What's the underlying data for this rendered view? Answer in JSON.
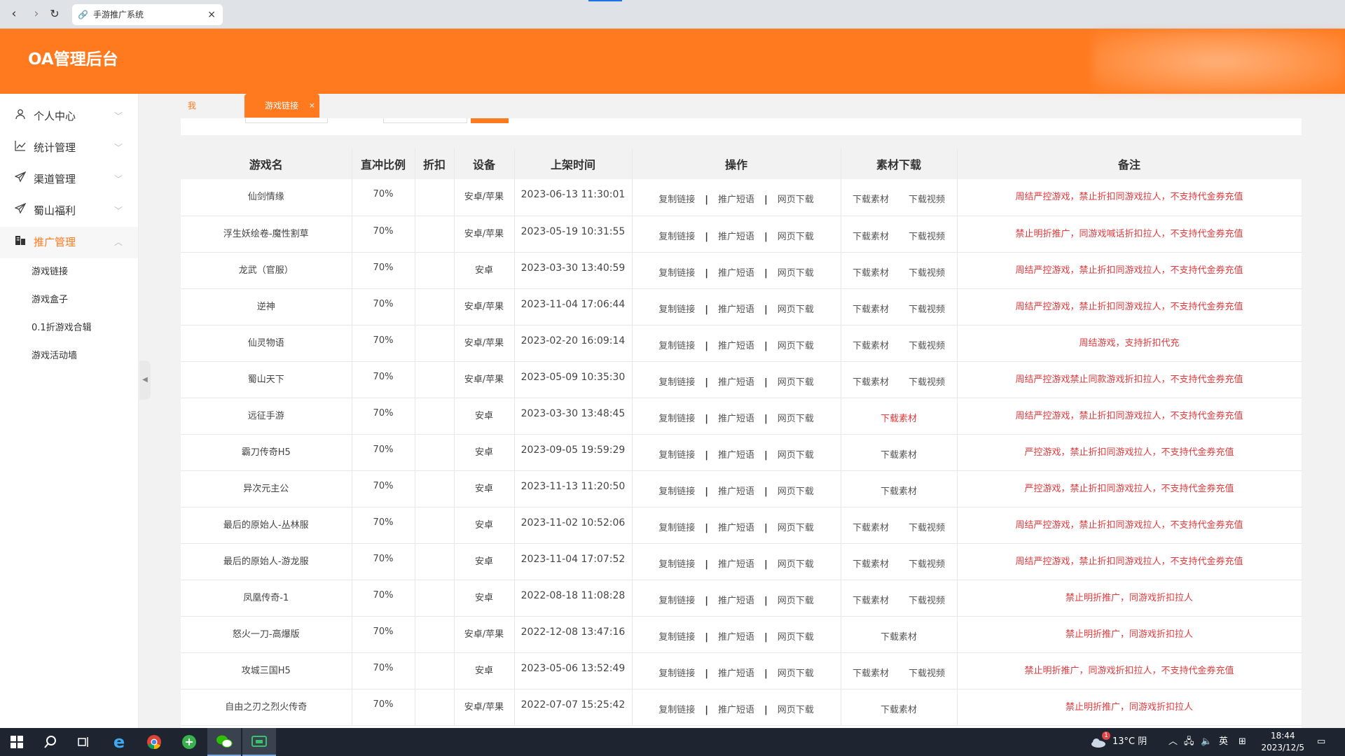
{
  "browser": {
    "tab_title": "手游推广系统",
    "back": "‹",
    "forward": "›",
    "reload": "↻",
    "close": "×"
  },
  "header": {
    "brand": "OA管理后台"
  },
  "sidebar": {
    "menu": [
      {
        "label": "个人中心",
        "icon": "user-icon"
      },
      {
        "label": "统计管理",
        "icon": "chart-line-icon"
      },
      {
        "label": "渠道管理",
        "icon": "send-icon"
      },
      {
        "label": "蜀山福利",
        "icon": "send-icon"
      },
      {
        "label": "推广管理",
        "icon": "building-icon"
      }
    ],
    "submenu": [
      "游戏链接",
      "游戏盒子",
      "0.1折游戏合辑",
      "游戏活动墙"
    ]
  },
  "content_tabs": {
    "home": "我的桌面",
    "current": "游戏链接",
    "close": "×"
  },
  "table": {
    "headers": [
      "游戏名",
      "直冲比例",
      "折扣",
      "设备",
      "上架时间",
      "操作",
      "素材下载",
      "备注"
    ],
    "ops": [
      "复制链接",
      "推广短语",
      "网页下载"
    ],
    "mat_material": "下载素材",
    "mat_video": "下载视频",
    "rows": [
      {
        "name": "仙剑情缘",
        "ratio": "70%",
        "discount": "",
        "device": "安卓/苹果",
        "time": "2023-06-13 11:30:01",
        "mat": "both",
        "note": "周结严控游戏，禁止折扣同游戏拉人，不支持代金券充值"
      },
      {
        "name": "浮生妖绘卷-魔性割草",
        "ratio": "70%",
        "discount": "",
        "device": "安卓/苹果",
        "time": "2023-05-19 10:31:55",
        "mat": "both",
        "note": "禁止明折推广，同游戏喊话折扣拉人，不支持代金券充值"
      },
      {
        "name": "龙武（官服）",
        "ratio": "70%",
        "discount": "",
        "device": "安卓",
        "time": "2023-03-30 13:40:59",
        "mat": "both",
        "note": "周结严控游戏，禁止折扣同游戏拉人，不支持代金券充值"
      },
      {
        "name": "逆神",
        "ratio": "70%",
        "discount": "",
        "device": "安卓/苹果",
        "time": "2023-11-04 17:06:44",
        "mat": "both",
        "note": "周结严控游戏，禁止折扣同游戏拉人，不支持代金券充值"
      },
      {
        "name": "仙灵物语",
        "ratio": "70%",
        "discount": "",
        "device": "安卓/苹果",
        "time": "2023-02-20 16:09:14",
        "mat": "both",
        "note": "周结游戏，支持折扣代充"
      },
      {
        "name": "蜀山天下",
        "ratio": "70%",
        "discount": "",
        "device": "安卓/苹果",
        "time": "2023-05-09 10:35:30",
        "mat": "both",
        "note": "周结严控游戏禁止同款游戏折扣拉人，不支持代金券充值"
      },
      {
        "name": "远征手游",
        "ratio": "70%",
        "discount": "",
        "device": "安卓",
        "time": "2023-03-30 13:48:45",
        "mat": "red",
        "note": "周结严控游戏，禁止折扣同游戏拉人，不支持代金券充值"
      },
      {
        "name": "霸刀传奇H5",
        "ratio": "70%",
        "discount": "",
        "device": "安卓",
        "time": "2023-09-05 19:59:29",
        "mat": "material",
        "note": "严控游戏，禁止折扣同游戏拉人，不支持代金券充值"
      },
      {
        "name": "异次元主公",
        "ratio": "70%",
        "discount": "",
        "device": "安卓",
        "time": "2023-11-13 11:20:50",
        "mat": "material",
        "note": "严控游戏，禁止折扣同游戏拉人，不支持代金券充值"
      },
      {
        "name": "最后的原始人-丛林服",
        "ratio": "70%",
        "discount": "",
        "device": "安卓",
        "time": "2023-11-02 10:52:06",
        "mat": "both",
        "note": "周结严控游戏，禁止折扣同游戏拉人，不支持代金券充值"
      },
      {
        "name": "最后的原始人-游龙服",
        "ratio": "70%",
        "discount": "",
        "device": "安卓",
        "time": "2023-11-04 17:07:52",
        "mat": "both",
        "note": "周结严控游戏，禁止折扣同游戏拉人，不支持代金券充值"
      },
      {
        "name": "凤凰传奇-1",
        "ratio": "70%",
        "discount": "",
        "device": "安卓",
        "time": "2022-08-18 11:08:28",
        "mat": "both",
        "note": "禁止明折推广，同游戏折扣拉人"
      },
      {
        "name": "怒火一刀-高爆版",
        "ratio": "70%",
        "discount": "",
        "device": "安卓/苹果",
        "time": "2022-12-08 13:47:16",
        "mat": "material",
        "note": "禁止明折推广，同游戏折扣拉人"
      },
      {
        "name": "攻城三国H5",
        "ratio": "70%",
        "discount": "",
        "device": "安卓",
        "time": "2023-05-06 13:52:49",
        "mat": "both",
        "note": "禁止明折推广，同游戏折扣拉人，不支持代金券充值"
      },
      {
        "name": "自由之刃之烈火传奇",
        "ratio": "70%",
        "discount": "",
        "device": "安卓/苹果",
        "time": "2022-07-07 15:25:42",
        "mat": "material",
        "note": "禁止明折推广，同游戏折扣拉人"
      }
    ]
  },
  "taskbar": {
    "weather": "13°C 阴",
    "ime": "英",
    "time": "18:44",
    "date": "2023/12/5",
    "badge": "1"
  },
  "colors": {
    "accent": "#ff7a1f",
    "note_red": "#e4393c",
    "taskbar": "#1e2530"
  }
}
